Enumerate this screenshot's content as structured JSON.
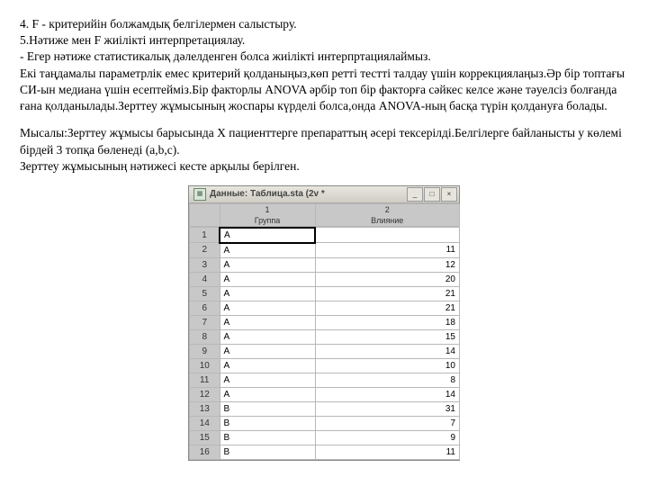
{
  "paragraphs": {
    "p1_line1": "4. F - критерийін болжамдық белгілермен салыстыру.",
    "p1_line2": "5.Нәтиже мен F жиілікті интерпретациялау.",
    "p1_line3": "-   Егер нәтиже статистикалық дәлелденген болса жиілікті интерпртациялаймыз.",
    "p1_line4": "Екі таңдамалы параметрлік емес критерий қолданыңыз,көп ретті тестті талдау үшін коррекциялаңыз.Әр бір топтағы  СИ-ын медиана үшін есептейміз.Бір факторлы ANOVA әрбір топ бір факторға сәйкес келсе және тәуелсіз болғанда ғана қолданылады.Зерттеу жұмысының жоспары күрделі болса,онда ANOVA-ның басқа түрін қолдануға болады.",
    "p2_line1": "Мысалы:Зерттеу жұмысы барысында Х пациенттерге препараттың әсері тексерілді.Белгілерге байланысты  у көлемі бірдей 3 топқа бөленеді (a,b,c).",
    "p2_line2": "Зерттеу жұмысының нәтижесі кесте арқылы берілген."
  },
  "window": {
    "title": "Данные: Таблица.sta (2v *",
    "col1_number": "1",
    "col2_number": "2",
    "col1_label": "Группа",
    "col2_label": "Влияние"
  },
  "table_rows": [
    {
      "n": "1",
      "g": "A",
      "v": ""
    },
    {
      "n": "2",
      "g": "A",
      "v": "11"
    },
    {
      "n": "3",
      "g": "A",
      "v": "12"
    },
    {
      "n": "4",
      "g": "A",
      "v": "20"
    },
    {
      "n": "5",
      "g": "A",
      "v": "21"
    },
    {
      "n": "6",
      "g": "A",
      "v": "21"
    },
    {
      "n": "7",
      "g": "A",
      "v": "18"
    },
    {
      "n": "8",
      "g": "A",
      "v": "15"
    },
    {
      "n": "9",
      "g": "A",
      "v": "14"
    },
    {
      "n": "10",
      "g": "A",
      "v": "10"
    },
    {
      "n": "11",
      "g": "A",
      "v": "8"
    },
    {
      "n": "12",
      "g": "A",
      "v": "14"
    },
    {
      "n": "13",
      "g": "B",
      "v": "31"
    },
    {
      "n": "14",
      "g": "B",
      "v": "7"
    },
    {
      "n": "15",
      "g": "B",
      "v": "9"
    },
    {
      "n": "16",
      "g": "B",
      "v": "11"
    }
  ]
}
